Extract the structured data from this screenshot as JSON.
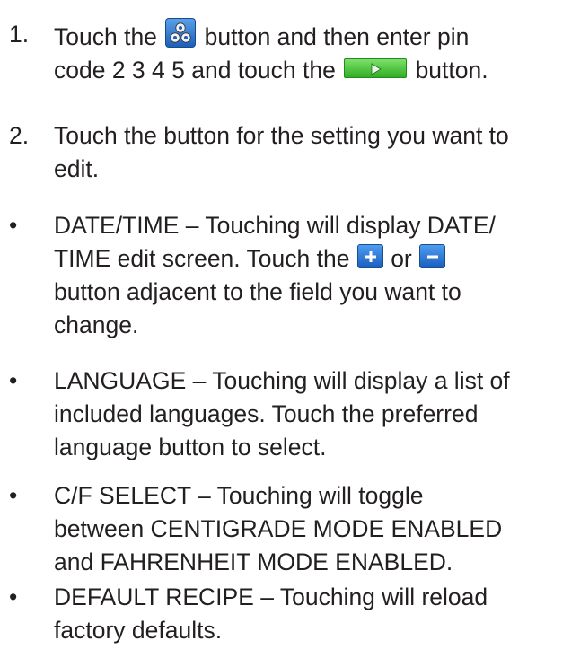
{
  "steps": [
    {
      "marker": "1.",
      "lines": [
        [
          "Touch the ",
          " button and then enter pin"
        ],
        [
          "code 2 3 4 5 and touch the ",
          " button."
        ]
      ],
      "icons": [
        "settings-icon",
        "go-arrow-icon"
      ]
    },
    {
      "marker": "2.",
      "lines": [
        [
          "Touch the button for the setting you want to"
        ],
        [
          "edit."
        ]
      ]
    }
  ],
  "bullets": [
    {
      "marker": "•",
      "lines": [
        [
          "DATE/TIME – Touching will display DATE/"
        ],
        [
          "TIME edit screen.  Touch the ",
          " or ",
          ""
        ],
        [
          "button adjacent to the field you want to"
        ],
        [
          "change."
        ]
      ],
      "icons": [
        "plus-icon",
        "minus-icon"
      ]
    },
    {
      "marker": "•",
      "lines": [
        [
          "LANGUAGE – Touching will display a list of"
        ],
        [
          "included languages.  Touch the preferred"
        ],
        [
          "language button to select."
        ]
      ]
    },
    {
      "marker": "•",
      "lines": [
        [
          "C/F SELECT – Touching will toggle"
        ],
        [
          "between CENTIGRADE MODE ENABLED"
        ],
        [
          "and FAHRENHEIT MODE ENABLED."
        ]
      ]
    },
    {
      "marker": "•",
      "lines": [
        [
          "DEFAULT RECIPE – Touching will reload"
        ],
        [
          "factory defaults."
        ]
      ]
    }
  ]
}
